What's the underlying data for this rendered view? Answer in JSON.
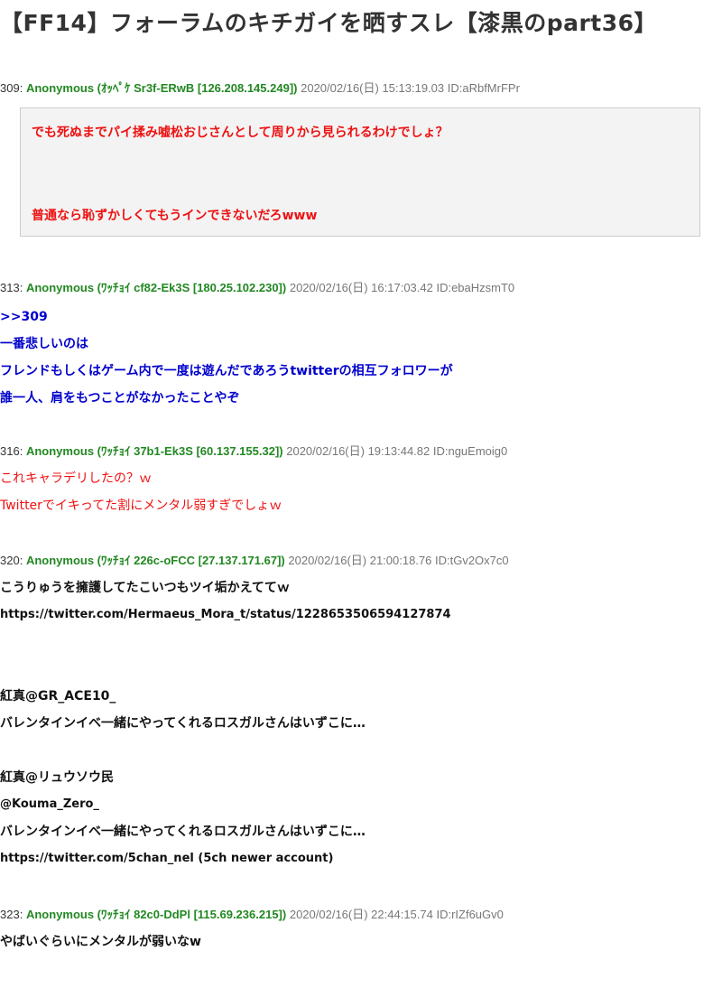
{
  "thread": {
    "title": "【FF14】フォーラムのキチガイを晒すスレ【漆黒のpart36】"
  },
  "posts": [
    {
      "number": "309:",
      "name": "Anonymous (ｵｯﾍﾟｹ Sr3f-ERwB [126.208.145.249])",
      "date": "2020/02/16(日) 15:13:19.03 ID:aRbfMrFPr",
      "lines": [
        "でも死ぬまでパイ揉み嘘松おじさんとして周りから見られるわけでしょ？",
        "普通なら恥ずかしくてもうインできないだろwww"
      ]
    },
    {
      "number": "313:",
      "name": "Anonymous (ﾜｯﾁｮｲ cf82-Ek3S [180.25.102.230])",
      "date": "2020/02/16(日) 16:17:03.42 ID:ebaHzsmT0",
      "lines": [
        ">>309",
        "一番悲しいのは",
        "フレンドもしくはゲーム内で一度は遊んだであろうtwitterの相互フォロワーが",
        "誰一人、肩をもつことがなかったことやぞ"
      ]
    },
    {
      "number": "316:",
      "name": "Anonymous (ﾜｯﾁｮｲ 37b1-Ek3S [60.137.155.32])",
      "date": "2020/02/16(日) 19:13:44.82 ID:nguEmoig0",
      "lines": [
        "これキャラデリしたの？ｗ",
        "Twitterでイキってた割にメンタル弱すぎでしょｗ"
      ]
    },
    {
      "number": "320:",
      "name": "Anonymous (ﾜｯﾁｮｲ 226c-oFCC [27.137.171.67])",
      "date": "2020/02/16(日) 21:00:18.76 ID:tGv2Ox7c0",
      "lines": [
        "こうりゅうを擁護してたこいつもツイ垢かえててｗ",
        "https://twitter.com/Hermaeus_Mora_t/status/1228653506594127874",
        "紅真@GR_ACE10_",
        "バレンタインイベ一緒にやってくれるロスガルさんはいずこに…",
        "紅真@リュウソウ民",
        "@Kouma_Zero_",
        "バレンタインイベ一緒にやってくれるロスガルさんはいずこに…",
        "https://twitter.com/5chan_nel",
        "(5ch newer account)"
      ]
    },
    {
      "number": "323:",
      "name": "Anonymous (ﾜｯﾁｮｲ 82c0-DdPl [115.69.236.215])",
      "date": "2020/02/16(日) 22:44:15.74 ID:rIZf6uGv0",
      "lines": [
        "やばいぐらいにメンタルが弱いなw"
      ]
    }
  ]
}
